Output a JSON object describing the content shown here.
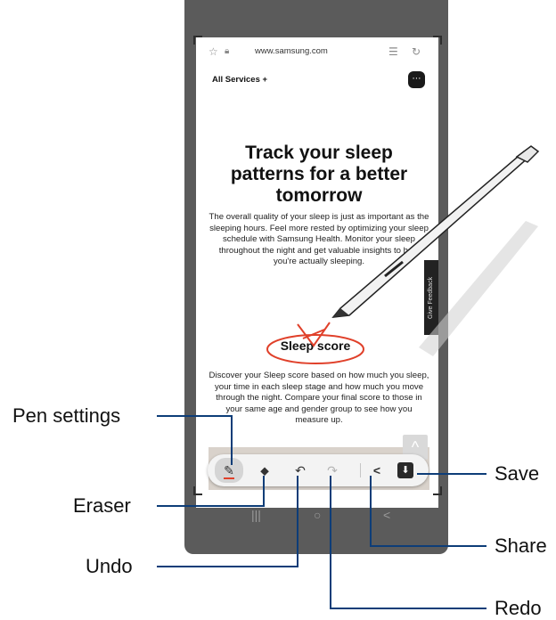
{
  "browser": {
    "url": "www.samsung.com",
    "icons": [
      "star-icon",
      "lock-icon",
      "reader-mode-icon",
      "refresh-icon"
    ]
  },
  "page_menu": {
    "all_services": "All Services +",
    "chat_icon": "chat-icon"
  },
  "article": {
    "headline": "Track your sleep patterns for a better tomorrow",
    "paragraph_1": "The overall quality of your sleep is just as important as the sleeping hours. Feel more rested by optimizing your sleep schedule with Samsung Health. Monitor your sleep throughout the night and get valuable insights to how you're actually sleeping.",
    "section_title": "Sleep score",
    "paragraph_2": "Discover your Sleep score based on how much you sleep, your time in each sleep stage and how much you move through the night. Compare your final score to those in your same age and gender group to see how you measure up."
  },
  "side_tab": {
    "label": "Give Feedback"
  },
  "toolbar": {
    "tools": [
      {
        "id": "pen",
        "icon": "pen-icon",
        "glyph": "✎"
      },
      {
        "id": "eraser",
        "icon": "eraser-icon",
        "glyph": "⬥"
      },
      {
        "id": "undo",
        "icon": "undo-icon",
        "glyph": "↶"
      },
      {
        "id": "redo",
        "icon": "redo-icon",
        "glyph": "↷"
      },
      {
        "id": "share",
        "icon": "share-icon",
        "glyph": "<"
      },
      {
        "id": "save",
        "icon": "save-icon",
        "glyph": "⬇"
      }
    ],
    "pen_color": "#e0402a"
  },
  "navbar": {
    "recents": "|||",
    "home": "○",
    "back": "<"
  },
  "callouts": {
    "pen_settings": "Pen settings",
    "eraser": "Eraser",
    "undo": "Undo",
    "save": "Save",
    "share": "Share",
    "redo": "Redo"
  },
  "colors": {
    "callout_line": "#0d3d78",
    "phone_frame": "#5b5b5b",
    "annotation": "#e0402a"
  }
}
